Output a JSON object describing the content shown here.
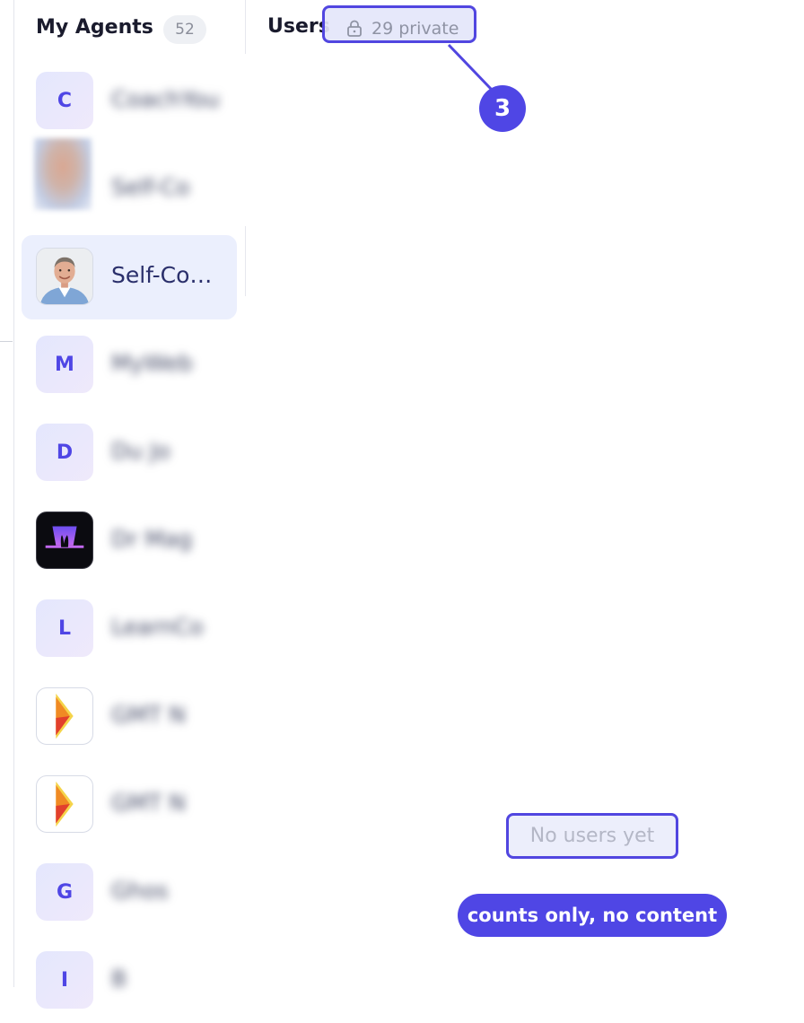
{
  "sidebar": {
    "title": "My Agents",
    "count": "52",
    "agents": [
      {
        "initial": "C",
        "name": "CoachYou",
        "blurred": true
      },
      {
        "initial": "",
        "name": "Self-Co",
        "blurred": true
      },
      {
        "initial": "",
        "name": "Self-Co…",
        "blurred": false,
        "active": true
      },
      {
        "initial": "M",
        "name": "MyWeb",
        "blurred": true
      },
      {
        "initial": "D",
        "name": "Du Jo",
        "blurred": true
      },
      {
        "initial": "",
        "name": "Dr Mag",
        "blurred": true
      },
      {
        "initial": "L",
        "name": "LearnCo",
        "blurred": true
      },
      {
        "initial": "",
        "name": "GMT N",
        "blurred": true
      },
      {
        "initial": "",
        "name": "GMT N",
        "blurred": true
      },
      {
        "initial": "G",
        "name": "Ghos",
        "blurred": true
      },
      {
        "initial": "I",
        "name": "B",
        "blurred": true
      }
    ]
  },
  "main": {
    "users_title": "Users",
    "private_label": "29 private",
    "empty_state": "No users yet"
  },
  "annotations": {
    "step_number": "3",
    "note": "counts only, no content"
  },
  "colors": {
    "accent": "#4f46e5",
    "active_row": "#ebeffd",
    "avatar_bg": "#e6e7fc"
  }
}
